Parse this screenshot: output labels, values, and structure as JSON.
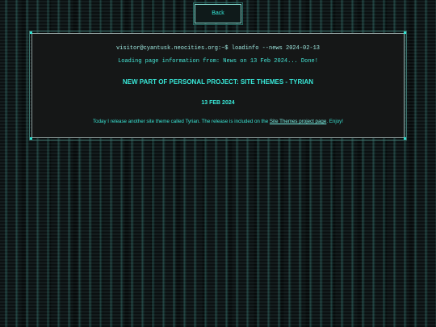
{
  "nav": {
    "back_label": "Back"
  },
  "terminal": {
    "command": "visitor@cyantusk.neocities.org:~$ loadinfo --news 2024-02-13",
    "loading": "Loading page information from: News on 13 Feb 2024... Done!"
  },
  "post": {
    "title": "NEW PART OF PERSONAL PROJECT: SITE THEMES - TYRIAN",
    "date": "13 FEB 2024",
    "body_before_link": "Today I release another site theme called Tyrian. The release is included on the ",
    "link_text": "Site Themes project page",
    "body_after_link": ". Enjoy!"
  },
  "colors": {
    "accent": "#33e0d0",
    "panel_bg": "#151717",
    "page_bg": "#0b1011"
  }
}
